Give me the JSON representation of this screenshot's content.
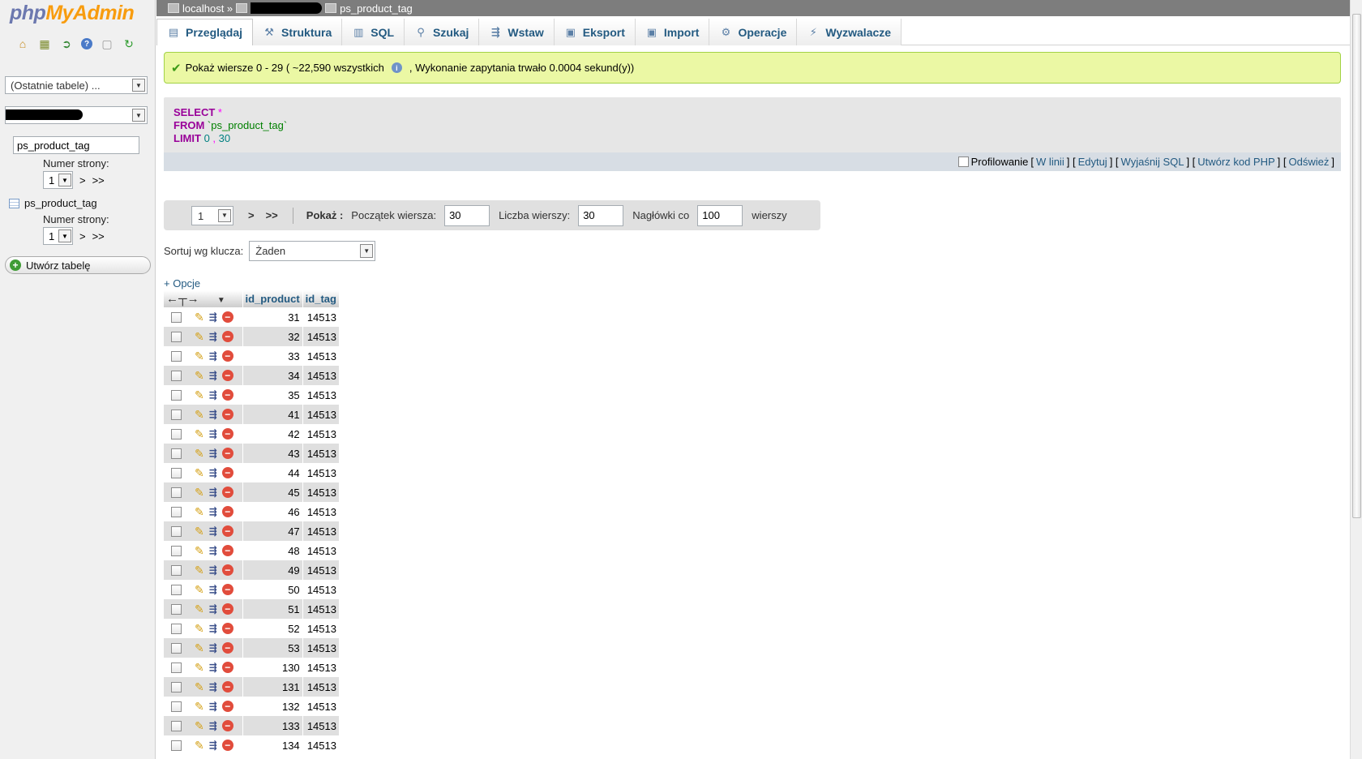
{
  "app": {
    "logo_php": "php",
    "logo_my": "MyAdmin"
  },
  "nav": {
    "icons": [
      "home-icon",
      "database-icon",
      "sql-query-icon",
      "help-icon",
      "documentation-icon",
      "reload-icon"
    ],
    "recent_tables": "(Ostatnie tabele) ...",
    "table_filter": "ps_product_tag",
    "page_label_1": "Numer strony:",
    "page_value_1": "1",
    "page_next_1": ">",
    "page_last_1": ">>",
    "table_name": "ps_product_tag",
    "page_label_2": "Numer strony:",
    "page_value_2": "1",
    "page_next_2": ">",
    "page_last_2": ">>",
    "create_table": "Utwórz tabelę"
  },
  "breadcrumb": {
    "server": "localhost »",
    "table": "ps_product_tag"
  },
  "tabs": [
    {
      "label": "Przeglądaj",
      "icon": "browse-icon"
    },
    {
      "label": "Struktura",
      "icon": "structure-icon"
    },
    {
      "label": "SQL",
      "icon": "sql-icon"
    },
    {
      "label": "Szukaj",
      "icon": "search-icon"
    },
    {
      "label": "Wstaw",
      "icon": "insert-icon"
    },
    {
      "label": "Eksport",
      "icon": "export-icon"
    },
    {
      "label": "Import",
      "icon": "import-icon"
    },
    {
      "label": "Operacje",
      "icon": "operations-icon"
    },
    {
      "label": "Wyzwalacze",
      "icon": "triggers-icon"
    }
  ],
  "message": {
    "part1": "Pokaż wiersze 0 - 29 ( ~22,590 wszystkich",
    "part2": ", Wykonanie zapytania trwało 0.0004 sekund(y))"
  },
  "sql": {
    "select": "SELECT",
    "star": "*",
    "from": "FROM",
    "table": "`ps_product_tag`",
    "limit": "LIMIT",
    "offset": "0",
    "comma": ",",
    "count": "30"
  },
  "sql_actions": {
    "profiling": "Profilowanie",
    "inline": "W linii",
    "edit": "Edytuj",
    "explain": "Wyjaśnij SQL",
    "php": "Utwórz kod PHP",
    "refresh": "Odśwież"
  },
  "navigation": {
    "page": "1",
    "next": ">",
    "last": ">>",
    "show": "Pokaż :",
    "start_label": "Początek wiersza:",
    "start_value": "30",
    "rows_label": "Liczba wierszy:",
    "rows_value": "30",
    "headers_label": "Nagłówki co",
    "headers_value": "100",
    "rows_suffix": "wierszy"
  },
  "sort": {
    "label": "Sortuj wg klucza:",
    "value": "Żaden"
  },
  "options_link": "+ Opcje",
  "table": {
    "columns": [
      "id_product",
      "id_tag"
    ],
    "rows": [
      [
        "31",
        "14513"
      ],
      [
        "32",
        "14513"
      ],
      [
        "33",
        "14513"
      ],
      [
        "34",
        "14513"
      ],
      [
        "35",
        "14513"
      ],
      [
        "41",
        "14513"
      ],
      [
        "42",
        "14513"
      ],
      [
        "43",
        "14513"
      ],
      [
        "44",
        "14513"
      ],
      [
        "45",
        "14513"
      ],
      [
        "46",
        "14513"
      ],
      [
        "47",
        "14513"
      ],
      [
        "48",
        "14513"
      ],
      [
        "49",
        "14513"
      ],
      [
        "50",
        "14513"
      ],
      [
        "51",
        "14513"
      ],
      [
        "52",
        "14513"
      ],
      [
        "53",
        "14513"
      ],
      [
        "130",
        "14513"
      ],
      [
        "131",
        "14513"
      ],
      [
        "132",
        "14513"
      ],
      [
        "133",
        "14513"
      ],
      [
        "134",
        "14513"
      ]
    ]
  }
}
